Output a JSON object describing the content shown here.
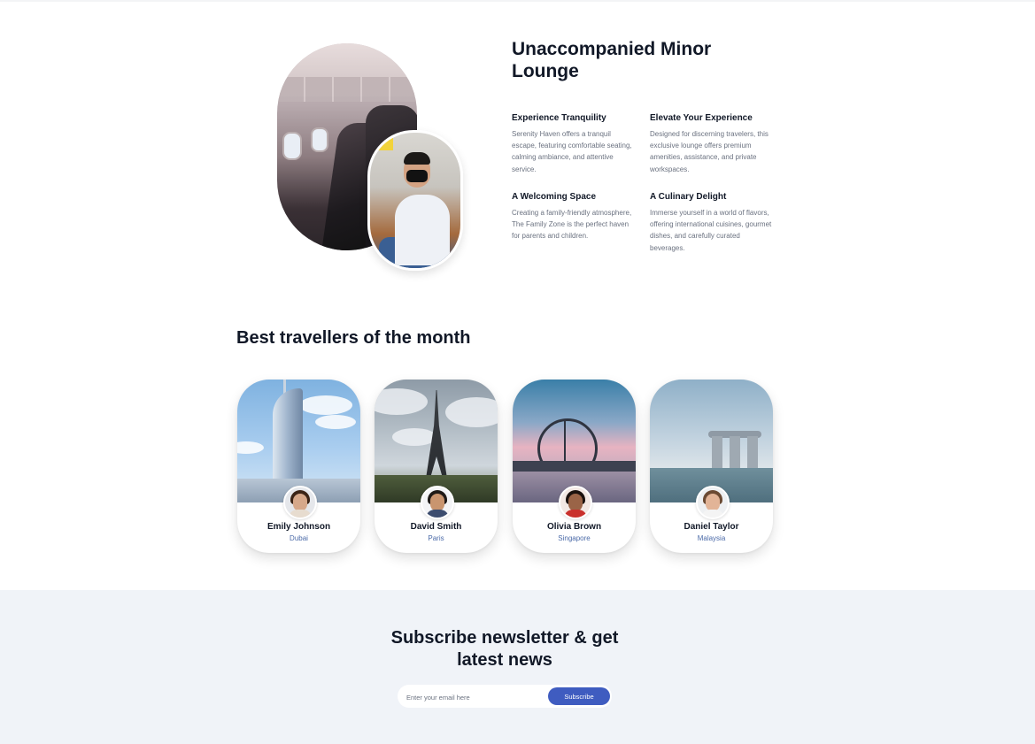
{
  "lounge": {
    "title": "Unaccompanied Minor Lounge",
    "features": [
      {
        "title": "Experience Tranquility",
        "text": "Serenity Haven offers a tranquil escape, featuring comfortable seating, calming ambiance, and attentive service."
      },
      {
        "title": "Elevate Your Experience",
        "text": "Designed for discerning travelers, this exclusive lounge offers premium amenities, assistance, and private workspaces."
      },
      {
        "title": "A Welcoming Space",
        "text": "Creating a family-friendly atmosphere, The Family Zone is the perfect haven for parents and children."
      },
      {
        "title": "A Culinary Delight",
        "text": "Immerse yourself in a world of flavors, offering international cuisines, gourmet dishes, and carefully curated beverages."
      }
    ]
  },
  "travellers": {
    "heading": "Best travellers of the month",
    "items": [
      {
        "name": "Emily Johnson",
        "city": "Dubai"
      },
      {
        "name": "David Smith",
        "city": "Paris"
      },
      {
        "name": "Olivia Brown",
        "city": "Singapore"
      },
      {
        "name": "Daniel Taylor",
        "city": "Malaysia"
      }
    ]
  },
  "newsletter": {
    "title": "Subscribe newsletter & get latest news",
    "placeholder": "Enter your email here",
    "button_label": "Subscribe"
  },
  "colors": {
    "accent": "#3f5cc0",
    "heading": "#111827",
    "body_text": "#6b7280",
    "city_text": "#4b6aa8",
    "newsletter_bg": "#f0f3f8"
  }
}
